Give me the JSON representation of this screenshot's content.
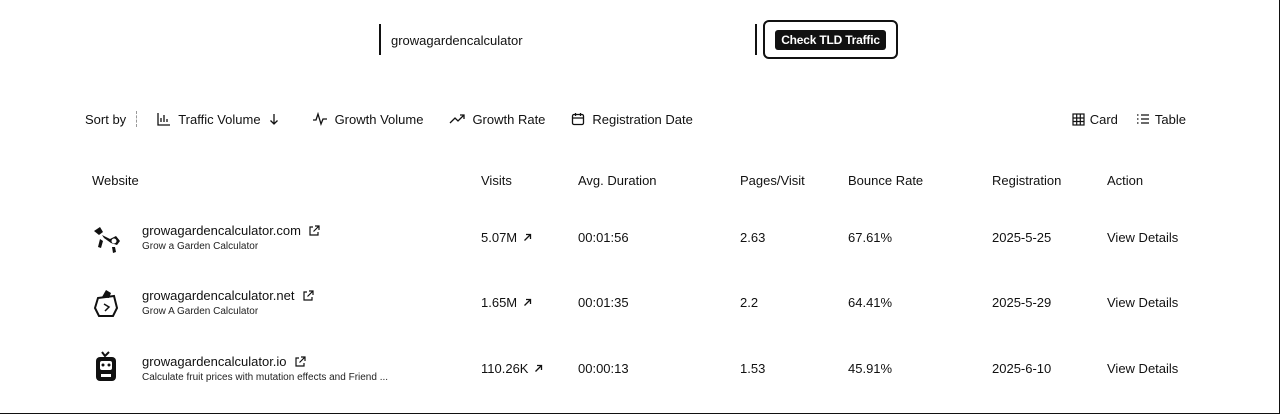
{
  "search": {
    "value": "growagardencalculator",
    "button_label": "Check TLD Traffic"
  },
  "sort": {
    "label": "Sort by",
    "options": [
      {
        "label": "Traffic Volume",
        "icon": "bar-chart-icon",
        "active": true
      },
      {
        "label": "Growth Volume",
        "icon": "activity-icon"
      },
      {
        "label": "Growth Rate",
        "icon": "trending-up-icon"
      },
      {
        "label": "Registration Date",
        "icon": "calendar-icon"
      }
    ]
  },
  "view": {
    "card_label": "Card",
    "table_label": "Table"
  },
  "table": {
    "headers": {
      "website": "Website",
      "visits": "Visits",
      "duration": "Avg. Duration",
      "pages": "Pages/Visit",
      "bounce": "Bounce Rate",
      "registration": "Registration",
      "action": "Action"
    },
    "rows": [
      {
        "name": "growagardencalculator.com",
        "description": "Grow a Garden Calculator",
        "visits": "5.07M",
        "duration": "00:01:56",
        "pages": "2.63",
        "bounce": "67.61%",
        "registration": "2025-5-25",
        "action": "View Details"
      },
      {
        "name": "growagardencalculator.net",
        "description": "Grow A Garden Calculator",
        "visits": "1.65M",
        "duration": "00:01:35",
        "pages": "2.2",
        "bounce": "64.41%",
        "registration": "2025-5-29",
        "action": "View Details"
      },
      {
        "name": "growagardencalculator.io",
        "description": "Calculate fruit prices with mutation effects and Friend ...",
        "visits": "110.26K",
        "duration": "00:00:13",
        "pages": "1.53",
        "bounce": "45.91%",
        "registration": "2025-6-10",
        "action": "View Details"
      }
    ]
  }
}
